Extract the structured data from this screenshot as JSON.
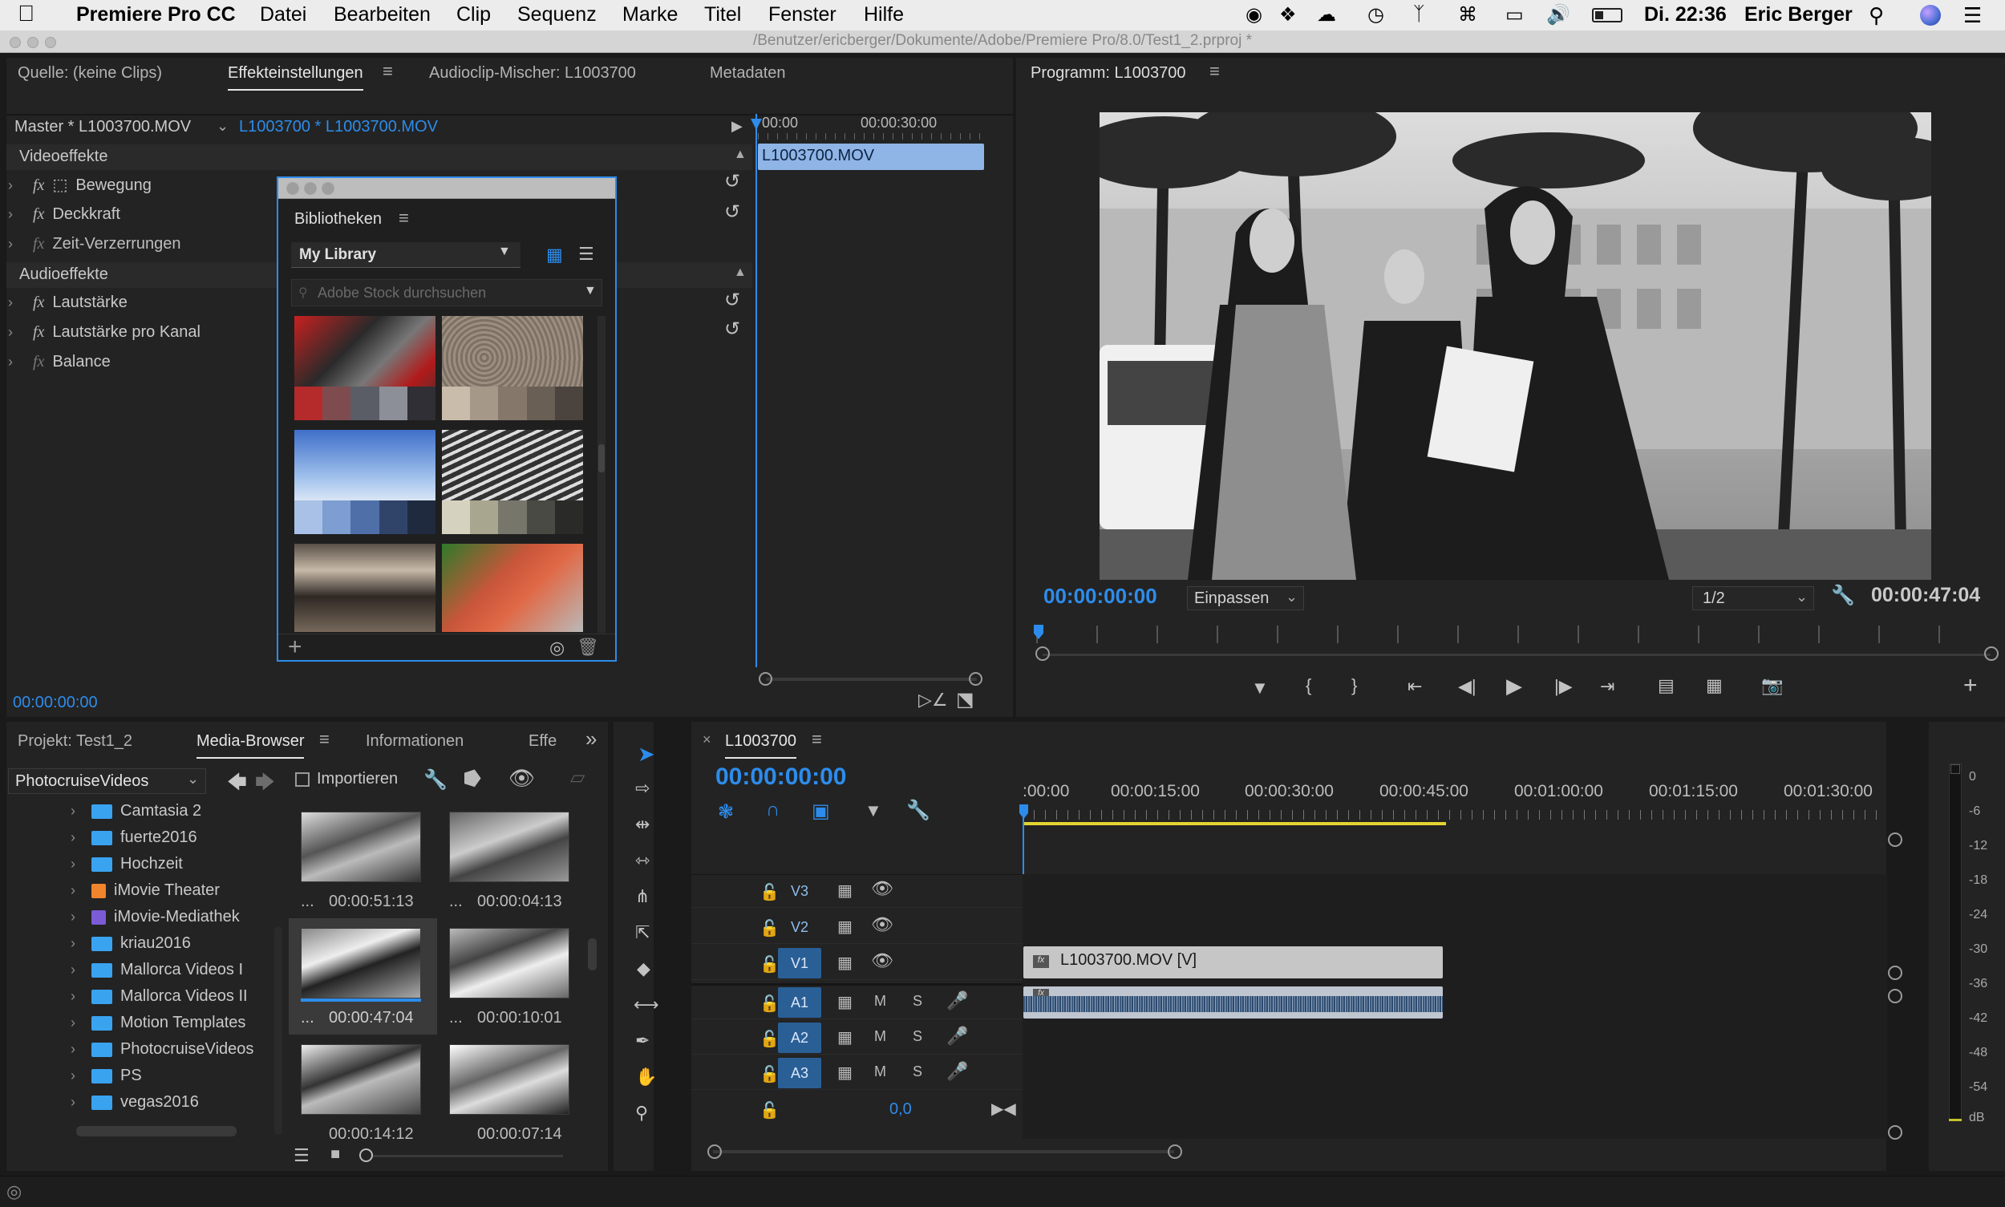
{
  "menubar": {
    "apple": "",
    "items": [
      "Premiere Pro CC",
      "Datei",
      "Bearbeiten",
      "Clip",
      "Sequenz",
      "Marke",
      "Titel",
      "Fenster",
      "Hilfe"
    ],
    "clock": "Di. 22:36",
    "user": "Eric Berger"
  },
  "titlebar": {
    "path": "/Benutzer/ericberger/Dokumente/Adobe/Premiere Pro/8.0/Test1_2.prproj *"
  },
  "source_panel": {
    "tabs": [
      "Quelle: (keine Clips)",
      "Effekteinstellungen",
      "Audioclip-Mischer: L1003700",
      "Metadaten"
    ],
    "master_label": "Master * L1003700.MOV",
    "sequence_label": "L1003700 * L1003700.MOV",
    "ruler": [
      "00:00",
      "00:00:30:00"
    ],
    "clip_name": "L1003700.MOV",
    "video_header": "Videoeffekte",
    "video_effects": [
      "Bewegung",
      "Deckkraft",
      "Zeit-Verzerrungen"
    ],
    "audio_header": "Audioeffekte",
    "audio_effects": [
      "Lautstärke",
      "Lautstärke pro Kanal",
      "Balance"
    ],
    "timecode": "00:00:00:00"
  },
  "libraries": {
    "title": "Bibliotheken",
    "library_name": "My Library",
    "search_placeholder": "Adobe Stock durchsuchen",
    "add": "+"
  },
  "program_panel": {
    "title": "Programm: L1003700",
    "timecode": "00:00:00:00",
    "zoom": "Einpassen",
    "resolution": "1/2",
    "duration": "00:00:47:04"
  },
  "project_panel": {
    "tabs": [
      "Projekt: Test1_2",
      "Media-Browser",
      "Informationen",
      "Effe"
    ],
    "location": "PhotocruiseVideos",
    "import_label": "Importieren",
    "folders": [
      "Camtasia 2",
      "fuerte2016",
      "Hochzeit",
      "iMovie Theater",
      "iMovie-Mediathek",
      "kriau2016",
      "Mallorca Videos I",
      "Mallorca Videos II",
      "Motion Templates",
      "PhotocruiseVideos",
      "PS",
      "vegas2016"
    ],
    "clips": [
      {
        "duration": "00:00:51:13",
        "more": "..."
      },
      {
        "duration": "00:00:04:13",
        "more": "..."
      },
      {
        "duration": "00:00:47:04",
        "more": "..."
      },
      {
        "duration": "00:00:10:01",
        "more": "..."
      },
      {
        "duration": "00:00:14:12",
        "more": ""
      },
      {
        "duration": "00:00:07:14",
        "more": ""
      }
    ]
  },
  "timeline": {
    "sequence_name": "L1003700",
    "timecode": "00:00:00:00",
    "ruler": [
      ":00:00",
      "00:00:15:00",
      "00:00:30:00",
      "00:00:45:00",
      "00:01:00:00",
      "00:01:15:00",
      "00:01:30:00"
    ],
    "video_tracks": [
      "V3",
      "V2",
      "V1"
    ],
    "audio_tracks": [
      "A1",
      "A2",
      "A3"
    ],
    "mute": "M",
    "solo": "S",
    "master_value": "0,0",
    "video_clip": "L1003700.MOV [V]"
  },
  "meter": {
    "scale": [
      "0",
      "-6",
      "-12",
      "-18",
      "-24",
      "-30",
      "-36",
      "-42",
      "-48",
      "-54",
      "dB"
    ]
  },
  "colors": {
    "accent": "#2d8ceb",
    "panel": "#232323",
    "background": "#1a1a1a",
    "track_active": "#2a5f96"
  }
}
